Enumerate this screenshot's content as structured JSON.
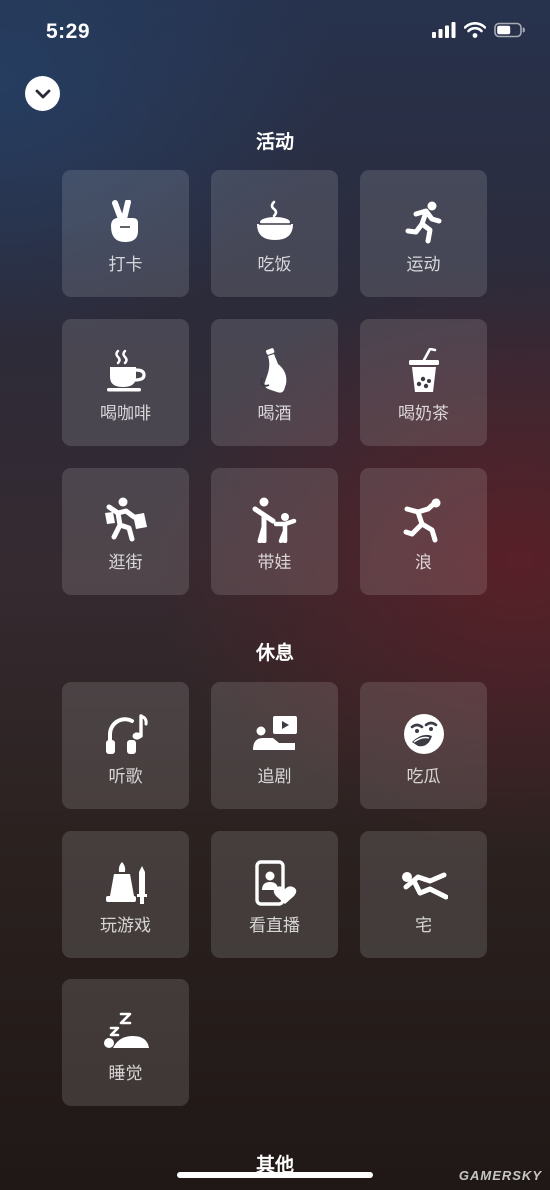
{
  "status_bar": {
    "time": "5:29",
    "battery_level": 0.6
  },
  "header": {
    "collapse_icon": "chevron-down-icon"
  },
  "sections": [
    {
      "title": "活动",
      "items": [
        {
          "label": "打卡",
          "icon": "victory-hand-icon"
        },
        {
          "label": "吃饭",
          "icon": "rice-bowl-icon"
        },
        {
          "label": "运动",
          "icon": "running-icon"
        },
        {
          "label": "喝咖啡",
          "icon": "coffee-cup-icon"
        },
        {
          "label": "喝酒",
          "icon": "wine-bottle-icon"
        },
        {
          "label": "喝奶茶",
          "icon": "bubble-tea-icon"
        },
        {
          "label": "逛街",
          "icon": "shopping-icon"
        },
        {
          "label": "带娃",
          "icon": "parent-child-icon"
        },
        {
          "label": "浪",
          "icon": "dancing-icon"
        }
      ]
    },
    {
      "title": "休息",
      "items": [
        {
          "label": "听歌",
          "icon": "headphones-music-icon"
        },
        {
          "label": "追剧",
          "icon": "watching-tv-icon"
        },
        {
          "label": "吃瓜",
          "icon": "eating-melon-face-icon"
        },
        {
          "label": "玩游戏",
          "icon": "game-pieces-icon"
        },
        {
          "label": "看直播",
          "icon": "live-stream-icon"
        },
        {
          "label": "宅",
          "icon": "lying-down-icon"
        },
        {
          "label": "睡觉",
          "icon": "sleeping-icon"
        }
      ]
    },
    {
      "title": "其他",
      "items": []
    }
  ],
  "watermark": "GAMERSKY"
}
